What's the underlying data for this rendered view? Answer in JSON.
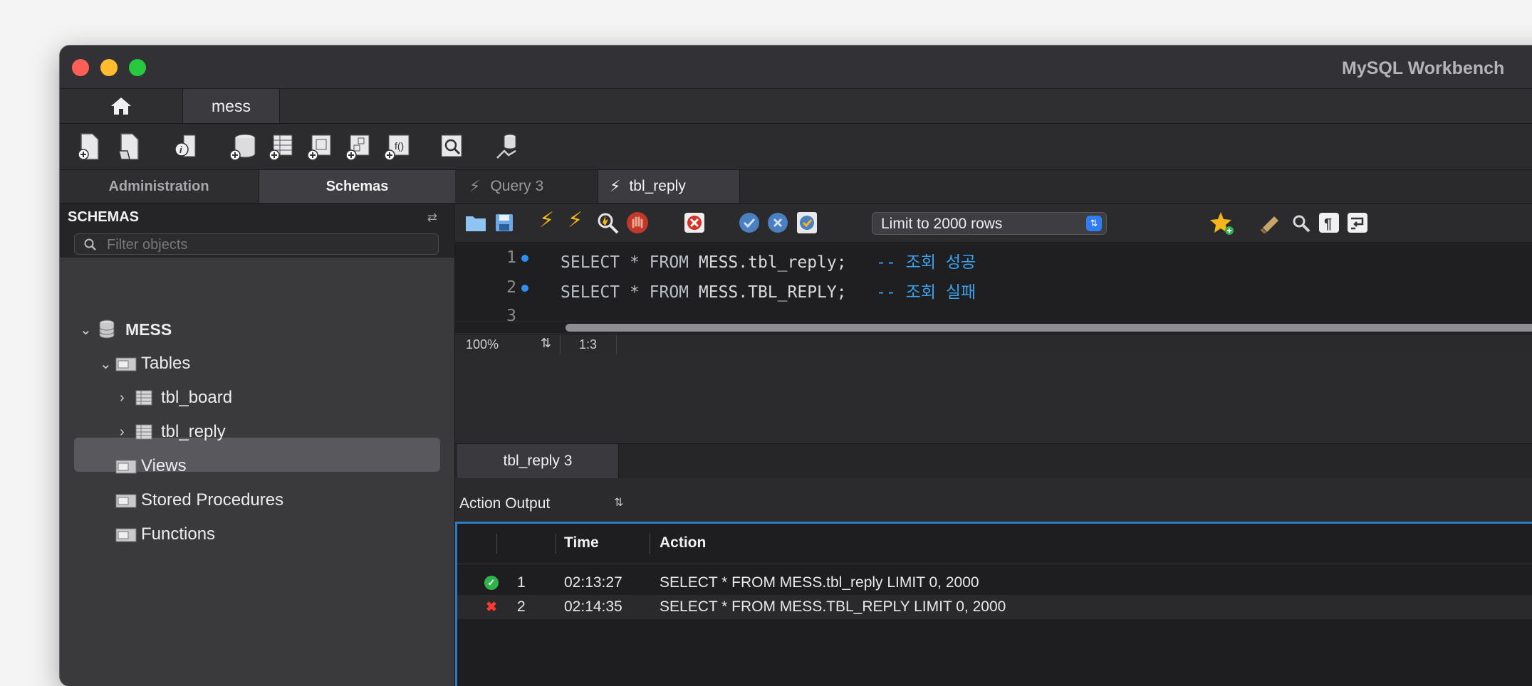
{
  "window": {
    "title": "MySQL Workbench"
  },
  "connection_tabs": {
    "home_icon": "home-icon",
    "active": "mess"
  },
  "sidebar": {
    "tabs": [
      "Administration",
      "Schemas"
    ],
    "header": "SCHEMAS",
    "filter_placeholder": "Filter objects",
    "tree": {
      "schema": "MESS",
      "tables_label": "Tables",
      "tables": [
        "tbl_board",
        "tbl_reply"
      ],
      "views": "Views",
      "procedures": "Stored Procedures",
      "functions": "Functions"
    }
  },
  "query_tabs": [
    "Query 3",
    "tbl_reply"
  ],
  "editor_toolbar": {
    "limit": "Limit to 2000 rows"
  },
  "editor": {
    "lines": [
      {
        "num": "1",
        "kw1": "SELECT",
        "star": " * ",
        "kw2": "FROM",
        "target": " MESS.tbl_reply;",
        "comment": "-- 조회 성공"
      },
      {
        "num": "2",
        "kw1": "SELECT",
        "star": " * ",
        "kw2": "FROM",
        "target": " MESS.TBL_REPLY;",
        "comment": "-- 조회 실패"
      },
      {
        "num": "3"
      }
    ]
  },
  "statusbar": {
    "zoom": "100%",
    "cursor": "1:3"
  },
  "result_tabs": [
    "tbl_reply 3"
  ],
  "output": {
    "selector": "Action Output",
    "headers": {
      "time": "Time",
      "action": "Action"
    },
    "rows": [
      {
        "status": "success",
        "num": "1",
        "time": "02:13:27",
        "action": "SELECT * FROM MESS.tbl_reply LIMIT 0, 2000"
      },
      {
        "status": "error",
        "num": "2",
        "time": "02:14:35",
        "action": "SELECT * FROM MESS.TBL_REPLY LIMIT 0, 2000"
      }
    ]
  },
  "colors": {
    "accent": "#2f7cf6",
    "comment": "#3aa2ee",
    "success": "#2fb34a",
    "error": "#ff3b30"
  }
}
